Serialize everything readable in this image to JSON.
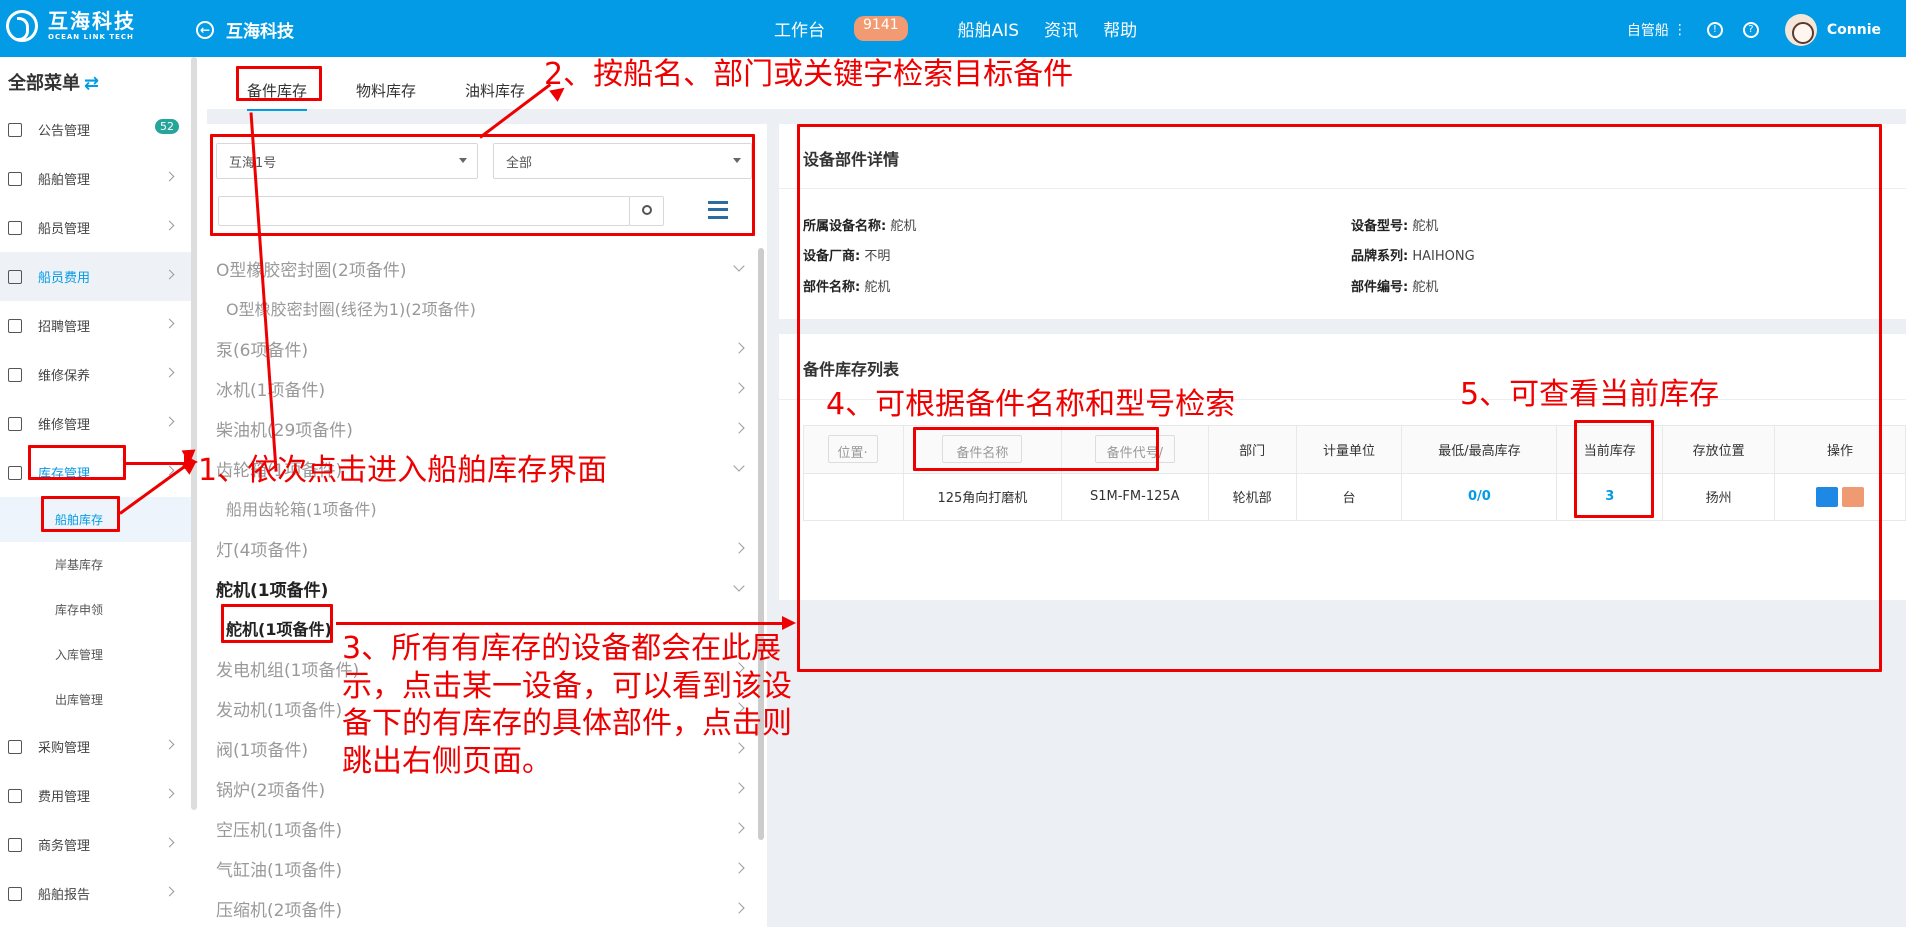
{
  "topbar": {
    "logo_cn": "互海科技",
    "logo_en": "OCEAN LINK TECH",
    "back_label": "互海科技",
    "nav": [
      {
        "label": "工作台"
      },
      {
        "label": "船舶AIS"
      },
      {
        "label": "资讯"
      },
      {
        "label": "帮助"
      }
    ],
    "workbench_count": "9141",
    "user_role": "自管船",
    "user_name": "Connie"
  },
  "sidebar": {
    "title": "全部菜单",
    "items": [
      {
        "label": "公告管理",
        "badge": "52"
      },
      {
        "label": "船舶管理"
      },
      {
        "label": "船员管理"
      },
      {
        "label": "船员费用"
      },
      {
        "label": "招聘管理"
      },
      {
        "label": "维修保养"
      },
      {
        "label": "维修管理"
      },
      {
        "label": "库存管理"
      }
    ],
    "subitems": [
      {
        "label": "船舶库存"
      },
      {
        "label": "岸基库存"
      },
      {
        "label": "库存申领"
      },
      {
        "label": "入库管理"
      },
      {
        "label": "出库管理"
      }
    ],
    "more_items": [
      {
        "label": "采购管理"
      },
      {
        "label": "费用管理"
      },
      {
        "label": "商务管理"
      },
      {
        "label": "船舶报告"
      }
    ]
  },
  "tabs": [
    {
      "label": "备件库存"
    },
    {
      "label": "物料库存"
    },
    {
      "label": "油料库存"
    }
  ],
  "filters": {
    "ship": "互海1号",
    "department": "全部"
  },
  "tree": [
    {
      "label": "O型橡胶密封圈(2项备件)",
      "type": "group"
    },
    {
      "label": "O型橡胶密封圈(线径为1)(2项备件)",
      "type": "child"
    },
    {
      "label": "泵(6项备件)",
      "type": "group"
    },
    {
      "label": "冰机(1项备件)",
      "type": "group"
    },
    {
      "label": "柴油机(29项备件)",
      "type": "group"
    },
    {
      "label": "齿轮箱(1项备件)",
      "type": "group"
    },
    {
      "label": "船用齿轮箱(1项备件)",
      "type": "child"
    },
    {
      "label": "灯(4项备件)",
      "type": "group"
    },
    {
      "label": "舵机(1项备件)",
      "type": "group-bold"
    },
    {
      "label": "舵机(1项备件)",
      "type": "child-active"
    },
    {
      "label": "发电机组(1项备件)",
      "type": "group"
    },
    {
      "label": "发动机(1项备件)",
      "type": "group"
    },
    {
      "label": "阀(1项备件)",
      "type": "group"
    },
    {
      "label": "锅炉(2项备件)",
      "type": "group"
    },
    {
      "label": "空压机(1项备件)",
      "type": "group"
    },
    {
      "label": "气缸油(1项备件)",
      "type": "group"
    },
    {
      "label": "压缩机(2项备件)",
      "type": "group"
    }
  ],
  "detail": {
    "title": "设备部件详情",
    "fields": [
      {
        "label": "所属设备名称:",
        "value": "舵机"
      },
      {
        "label": "设备厂商:",
        "value": "不明"
      },
      {
        "label": "部件名称:",
        "value": "舵机"
      },
      {
        "label": "设备型号:",
        "value": "舵机"
      },
      {
        "label": "品牌系列:",
        "value": "HAIHONG"
      },
      {
        "label": "部件编号:",
        "value": "舵机"
      }
    ]
  },
  "inventory": {
    "title": "备件库存列表",
    "placeholders": {
      "location": "位置·",
      "name": "备件名称",
      "code": "备件代号/"
    },
    "headers": [
      "部门",
      "计量单位",
      "最低/最高库存",
      "当前库存",
      "存放位置",
      "操作"
    ],
    "rows": [
      {
        "name": "125角向打磨机",
        "code": "S1M-FM-125A",
        "department": "轮机部",
        "unit": "台",
        "minmax": "0/0",
        "current": "3",
        "location": "扬州"
      }
    ]
  },
  "annotations": [
    {
      "label": "1、依次点击进入船舶库存界面"
    },
    {
      "label": "2、按船名、部门或关键字检索目标备件"
    },
    {
      "label": "3、所有有库存的设备都会在此展示，点击某一设备，可以看到该设备下的有库存的具体部件，点击则跳出右侧页面。"
    },
    {
      "label": "4、可根据备件名称和型号检索"
    },
    {
      "label": "5、可查看当前库存"
    }
  ],
  "colors": {
    "primary": "#039be5",
    "annotation": "#ee0000",
    "badge": "#f29b73"
  }
}
